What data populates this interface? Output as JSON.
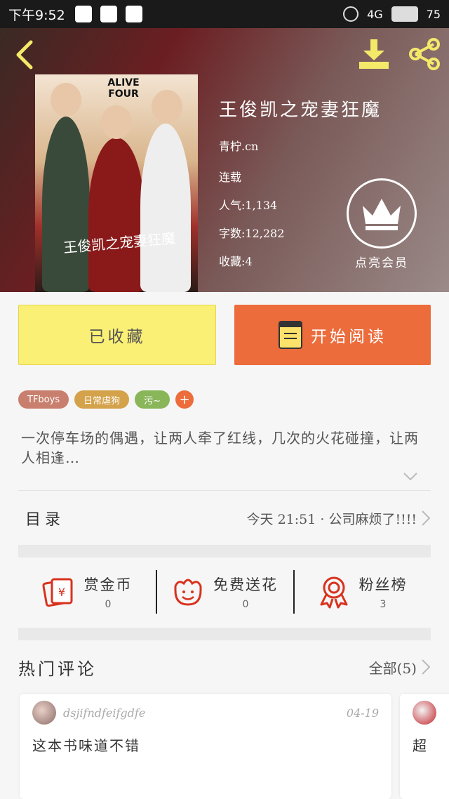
{
  "status_bar": {
    "time": "下午9:52",
    "notif_icons": [
      "chat-bubble-icon",
      "news-icon",
      "mail-icon"
    ],
    "network": "4G",
    "battery": "75"
  },
  "header": {
    "back_icon": "back-chevron-icon",
    "download_icon": "download-icon",
    "share_icon": "share-icon",
    "cover_brand": "ALIVE FOUR",
    "cover_title": "王俊凯之宠妻狂魔"
  },
  "book": {
    "title": "王俊凯之宠妻狂魔",
    "site": "青柠.cn",
    "status": "连载",
    "popularity": "人气:1,134",
    "word_count": "字数:12,282",
    "favorites": "收藏:4"
  },
  "vip": {
    "label": "点亮会员",
    "icon": "crown-icon"
  },
  "actions": {
    "favorited": "已收藏",
    "start_reading": "开始阅读"
  },
  "tags": [
    {
      "label": "TFboys",
      "color": "#c97f6e"
    },
    {
      "label": "日常虐狗",
      "color": "#d4a24a"
    },
    {
      "label": "污~",
      "color": "#8ab65a"
    },
    {
      "label": "+",
      "color": "#ec6c3c"
    }
  ],
  "summary": "一次停车场的偶遇，让两人牵了红线，几次的火花碰撞，让两人相逢…",
  "toc": {
    "label": "目录",
    "latest": "今天 21:51 · 公司麻烦了!!!!"
  },
  "stats": [
    {
      "label": "赏金币",
      "value": "0",
      "icon": "gold-coin-icon"
    },
    {
      "label": "免费送花",
      "value": "0",
      "icon": "flower-icon"
    },
    {
      "label": "粉丝榜",
      "value": "3",
      "icon": "medal-icon"
    }
  ],
  "comments": {
    "title": "热门评论",
    "all": "全部(5)",
    "items": [
      {
        "user": "dsjifndfeifgdfe",
        "date": "04-19",
        "text": "这本书味道不错"
      },
      {
        "text": "超"
      }
    ]
  },
  "colors": {
    "accent": "#ec6c3c",
    "favorite_bg": "#fbf076",
    "icon_red": "#d8321e"
  }
}
